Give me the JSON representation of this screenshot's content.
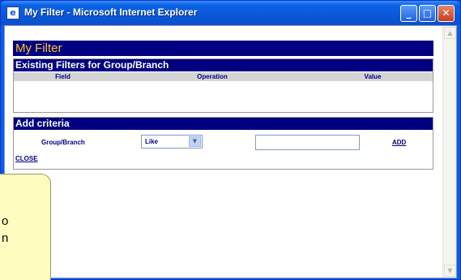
{
  "window": {
    "title": "My Filter - Microsoft Internet Explorer",
    "icon": "ie-page-icon",
    "buttons": {
      "minimize_glyph": "_",
      "maximize_glyph": "□",
      "close_glyph": "✕"
    }
  },
  "page": {
    "title": "My Filter",
    "existing": {
      "header": "Existing Filters for Group/Branch",
      "columns": [
        "Field",
        "Operation",
        "Value"
      ]
    },
    "criteria": {
      "header": "Add criteria",
      "field_label": "Group/Branch",
      "operation_selected": "Like",
      "value_input": "",
      "add_label": "ADD",
      "close_label": "CLOSE"
    }
  },
  "callout": {
    "lines": [
      "o",
      "n"
    ]
  },
  "scrollbar": {
    "up_glyph": "▲",
    "down_glyph": "▼"
  },
  "colors": {
    "header_navy": "#000080",
    "title_yellow": "#ffc628",
    "xp_blue": "#0b5de6",
    "callout_bg": "#fffcc0"
  }
}
